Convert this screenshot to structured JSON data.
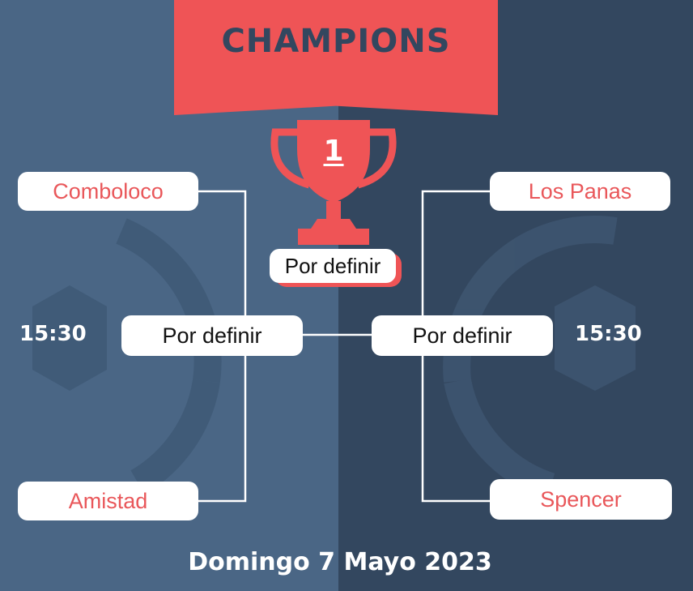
{
  "header": {
    "title": "CHAMPIONS"
  },
  "trophy": {
    "rank": "1"
  },
  "final": {
    "label": "Por definir"
  },
  "left_bracket": {
    "team_top": "Comboloco",
    "team_bottom": "Amistad",
    "semifinal": "Por definir",
    "time": "15:30"
  },
  "right_bracket": {
    "team_top": "Los Panas",
    "team_bottom": "Spencer",
    "semifinal": "Por definir",
    "time": "15:30"
  },
  "footer": {
    "date": "Domingo 7 Mayo 2023"
  },
  "colors": {
    "accent": "#ef5456",
    "bg_left": "#4a6685",
    "bg_right": "#33475f",
    "text_white": "#ffffff"
  }
}
